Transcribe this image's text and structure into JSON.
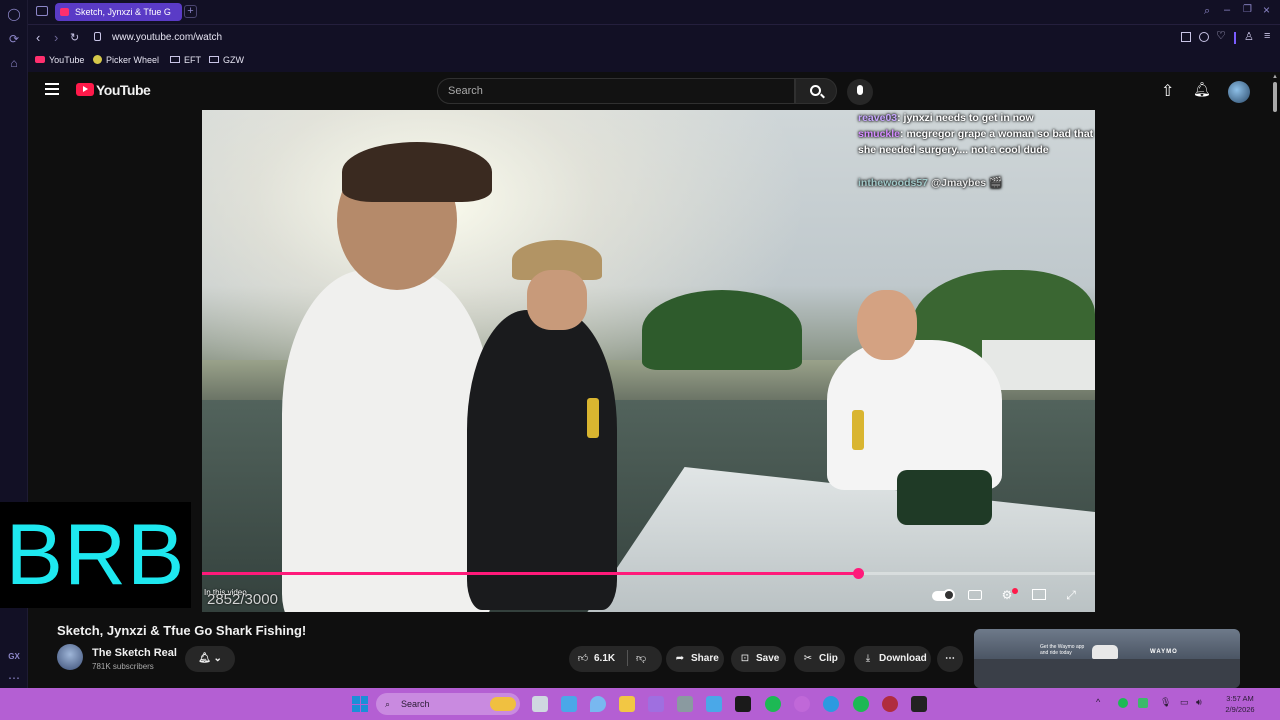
{
  "browser": {
    "tab_title": "Sketch, Jynxzi & Tfue G",
    "url": "www.youtube.com/watch",
    "bookmarks": [
      "YouTube",
      "Picker Wheel",
      "EFT",
      "GZW"
    ],
    "sidebar_bottom_label": "GX"
  },
  "youtube": {
    "logo_text": "YouTube",
    "search_placeholder": "Search",
    "video": {
      "chat": [
        {
          "user": "reave03",
          "message": "jynxzi needs to get in now"
        },
        {
          "user": "smuckle",
          "message": "mcgregor grape a woman so bad that she needed surgery.... not a cool dude"
        },
        {
          "user": "inthewoods57",
          "message": "@Jmaybes 🎬"
        }
      ],
      "in_this_video_label": "In this video",
      "counter_text": "2852/3000",
      "progress_fraction": 0.735
    },
    "brb_overlay_text": "BRB",
    "title": "Sketch, Jynxzi & Tfue Go Shark Fishing!",
    "channel_name": "The Sketch Real",
    "subscribers": "781K subscribers",
    "actions": {
      "like_count": "6.1K",
      "share_label": "Share",
      "save_label": "Save",
      "clip_label": "Clip",
      "download_label": "Download"
    },
    "ad_card": {
      "brand": "WAYMO",
      "tagline": "Get the Waymo app and ride today"
    }
  },
  "taskbar": {
    "search_placeholder": "Search",
    "time": "3:57 AM",
    "date": "2/9/2026"
  },
  "colors": {
    "progress": "#ff1a7a",
    "brb_text": "#1ee8f0",
    "taskbar": "#b45fd3",
    "opera_tab": "#5a3bc6"
  }
}
